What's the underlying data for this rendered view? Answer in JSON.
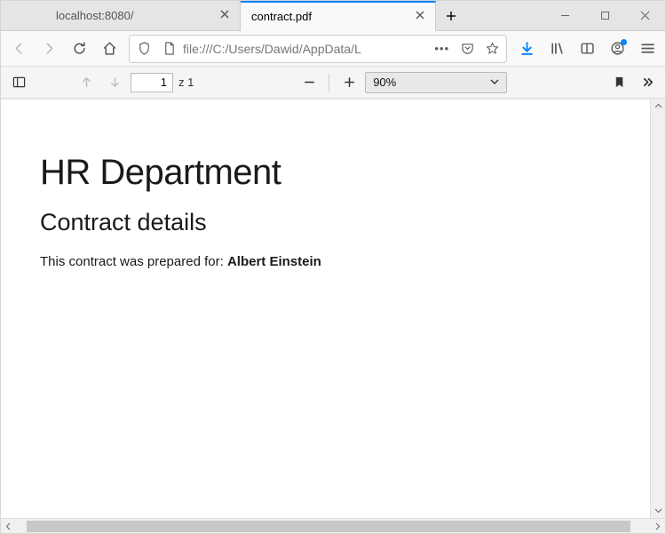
{
  "tabs": [
    {
      "label": "localhost:8080/",
      "active": false
    },
    {
      "label": "contract.pdf",
      "active": true
    }
  ],
  "url": "file:///C:/Users/Dawid/AppData/L",
  "pdf": {
    "page_current": "1",
    "page_sep": "z",
    "page_total": "1",
    "zoom": "90%"
  },
  "document": {
    "h1": "HR Department",
    "h2": "Contract details",
    "intro_prefix": "This contract was prepared for: ",
    "intro_name": "Albert Einstein"
  }
}
